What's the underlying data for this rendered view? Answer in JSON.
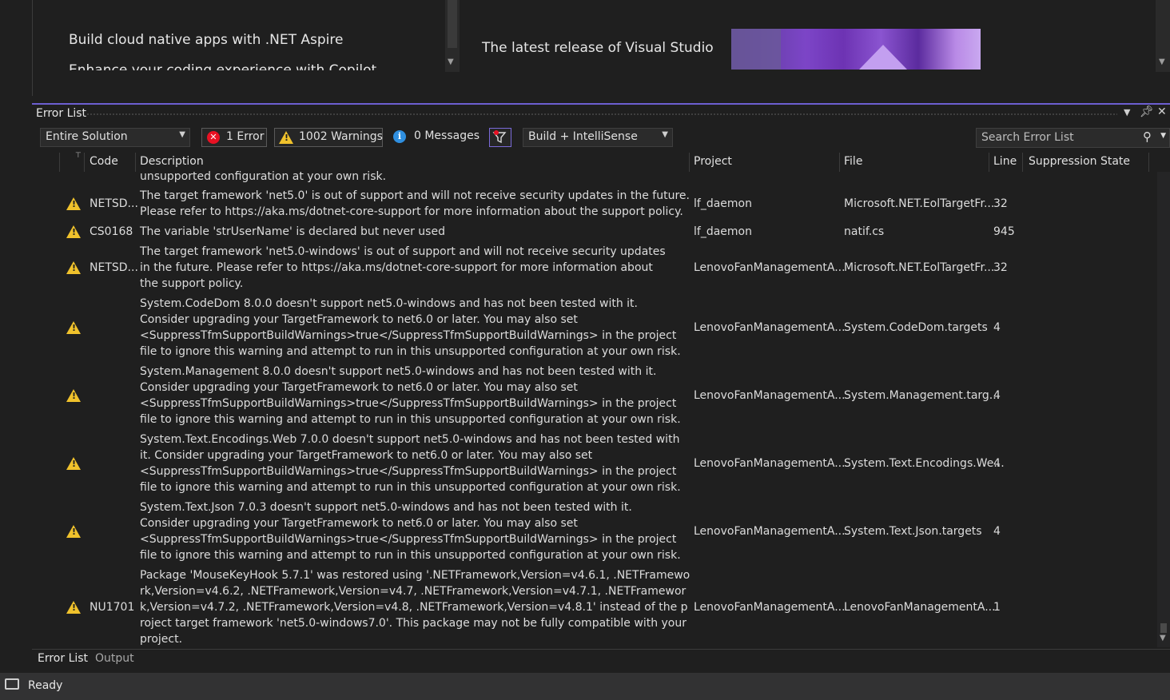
{
  "news": {
    "left_items": [
      "Build cloud native apps with .NET Aspire",
      "Enhance your coding experience with Copilot"
    ],
    "right_title": "The latest release of Visual Studio"
  },
  "panel": {
    "title": "Error List"
  },
  "toolbar": {
    "scope": "Entire Solution",
    "errors_label": "1 Error",
    "warnings_label": "1002 Warnings",
    "messages_label": "0 Messages",
    "source": "Build + IntelliSense",
    "search_placeholder": "Search Error List"
  },
  "columns": {
    "code": "Code",
    "description": "Description",
    "project": "Project",
    "file": "File",
    "line": "Line",
    "suppression": "Suppression State"
  },
  "partial_row": "unsupported configuration at your own risk.",
  "rows": [
    {
      "code": "NETSD...",
      "description": "The target framework 'net5.0' is out of support and will not receive security updates in the future. Please refer to https://aka.ms/dotnet-core-support for more information about the support policy.",
      "project": "lf_daemon",
      "file": "Microsoft.NET.EolTargetFr...",
      "line": "32"
    },
    {
      "code": "CS0168",
      "description": "The variable 'strUserName' is declared but never used",
      "project": "lf_daemon",
      "file": "natif.cs",
      "line": "945"
    },
    {
      "code": "NETSD...",
      "description": "The target framework 'net5.0-windows' is out of support and will not receive security updates in the future. Please refer to https://aka.ms/dotnet-core-support for more information about the support policy.",
      "project": "LenovoFanManagementA...",
      "file": "Microsoft.NET.EolTargetFr...",
      "line": "32"
    },
    {
      "code": "",
      "description": "System.CodeDom 8.0.0 doesn't support net5.0-windows and has not been tested with it. Consider upgrading your TargetFramework to net6.0 or later. You may also set <SuppressTfmSupportBuildWarnings>true</SuppressTfmSupportBuildWarnings> in the project file to ignore this warning and attempt to run in this unsupported configuration at your own risk.",
      "project": "LenovoFanManagementA...",
      "file": "System.CodeDom.targets",
      "line": "4"
    },
    {
      "code": "",
      "description": "System.Management 8.0.0 doesn't support net5.0-windows and has not been tested with it. Consider upgrading your TargetFramework to net6.0 or later. You may also set <SuppressTfmSupportBuildWarnings>true</SuppressTfmSupportBuildWarnings> in the project file to ignore this warning and attempt to run in this unsupported configuration at your own risk.",
      "project": "LenovoFanManagementA...",
      "file": "System.Management.targ...",
      "line": "4"
    },
    {
      "code": "",
      "description": "System.Text.Encodings.Web 7.0.0 doesn't support net5.0-windows and has not been tested with it. Consider upgrading your TargetFramework to net6.0 or later. You may also set <SuppressTfmSupportBuildWarnings>true</SuppressTfmSupportBuildWarnings> in the project file to ignore this warning and attempt to run in this unsupported configuration at your own risk.",
      "project": "LenovoFanManagementA...",
      "file": "System.Text.Encodings.We...",
      "line": "4"
    },
    {
      "code": "",
      "description": "System.Text.Json 7.0.3 doesn't support net5.0-windows and has not been tested with it. Consider upgrading your TargetFramework to net6.0 or later. You may also set <SuppressTfmSupportBuildWarnings>true</SuppressTfmSupportBuildWarnings> in the project file to ignore this warning and attempt to run in this unsupported configuration at your own risk.",
      "project": "LenovoFanManagementA...",
      "file": "System.Text.Json.targets",
      "line": "4"
    },
    {
      "code": "NU1701",
      "description": "Package 'MouseKeyHook 5.7.1' was restored using '.NETFramework,Version=v4.6.1, .NETFramework,Version=v4.6.2, .NETFramework,Version=v4.7, .NETFramework,Version=v4.7.1, .NETFramework,Version=v4.7.2, .NETFramework,Version=v4.8, .NETFramework,Version=v4.8.1' instead of the project target framework 'net5.0-windows7.0'. This package may not be fully compatible with your project.",
      "project": "LenovoFanManagementA...",
      "file": "LenovoFanManagementA...",
      "line": "1"
    }
  ],
  "tabs": [
    "Error List",
    "Output"
  ],
  "status": "Ready",
  "colors": {
    "accent": "#6c5fd1",
    "warning": "#f0c22c",
    "error": "#e81123",
    "info": "#2f8fe0"
  }
}
